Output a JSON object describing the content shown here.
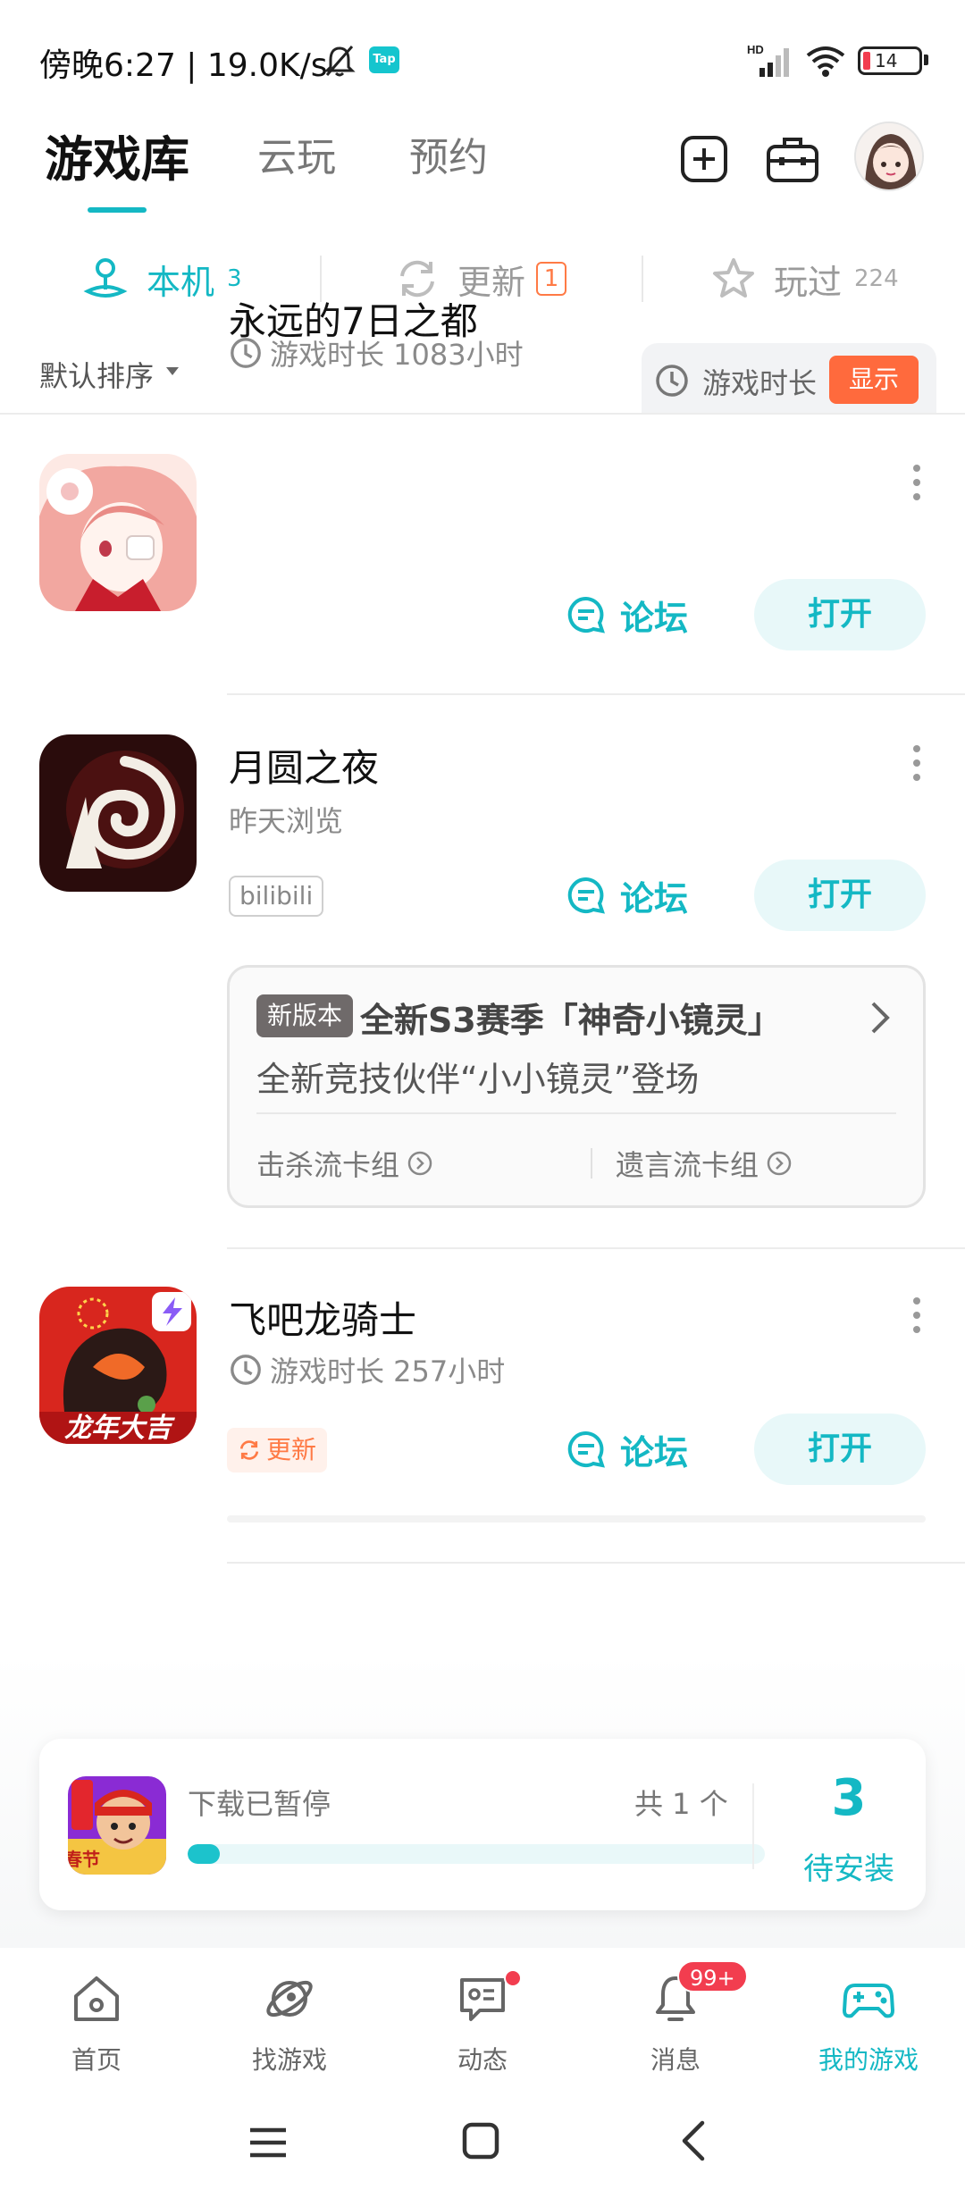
{
  "status_bar": {
    "time_speed": "傍晚6:27 | 19.0K/s",
    "tap_badge": "Tap",
    "battery": "14"
  },
  "header": {
    "tabs": [
      {
        "label": "游戏库",
        "active": true
      },
      {
        "label": "云玩",
        "active": false
      },
      {
        "label": "预约",
        "active": false
      }
    ]
  },
  "sub_tabs": [
    {
      "label": "本机",
      "count": "3",
      "active": true
    },
    {
      "label": "更新",
      "count": "1",
      "active": false
    },
    {
      "label": "玩过",
      "count": "224",
      "active": false
    }
  ],
  "sort": {
    "label": "默认排序",
    "duration_label": "游戏时长",
    "show_button": "显示"
  },
  "games": [
    {
      "title": "永远的7日之都",
      "subtitle": "游戏时长 1083小时",
      "forum": "论坛",
      "open": "打开"
    },
    {
      "title": "月圆之夜",
      "subtitle": "昨天浏览",
      "tag": "bilibili",
      "forum": "论坛",
      "open": "打开"
    },
    {
      "title": "飞吧龙骑士",
      "subtitle": "游戏时长 257小时",
      "tag": "更新",
      "forum": "论坛",
      "open": "打开",
      "icon_caption": "龙年大吉"
    }
  ],
  "news": {
    "badge": "新版本",
    "title": "全新S3赛季「神奇小镜灵」",
    "body": "全新竞技伙伴“小小镜灵”登场",
    "links": [
      "击杀流卡组",
      "遗言流卡组"
    ]
  },
  "download": {
    "status": "下载已暂停",
    "count": "共 1 个",
    "progress": 0.055,
    "pending_number": "3",
    "pending_label": "待安装",
    "icon_caption": "春节"
  },
  "bottom_nav": [
    {
      "label": "首页",
      "icon": "home-icon",
      "active": false
    },
    {
      "label": "找游戏",
      "icon": "planet-icon",
      "active": false
    },
    {
      "label": "动态",
      "icon": "feed-icon",
      "active": false
    },
    {
      "label": "消息",
      "icon": "bell-icon",
      "active": false,
      "badge": "99+"
    },
    {
      "label": "我的游戏",
      "icon": "gamepad-icon",
      "active": true
    }
  ],
  "colors": {
    "accent": "#14b8c4",
    "orange": "#ff7a45",
    "red": "#f23d4f"
  }
}
